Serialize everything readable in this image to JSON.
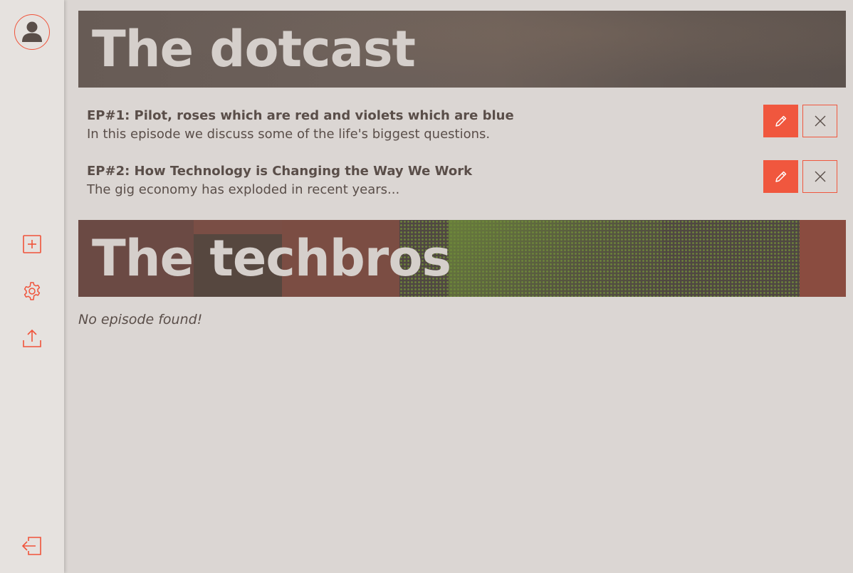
{
  "sidebar": {
    "avatar_icon": "user-avatar-icon",
    "actions": [
      {
        "name": "add-podcast",
        "icon": "plus-square-icon"
      },
      {
        "name": "settings",
        "icon": "gear-icon"
      },
      {
        "name": "upload",
        "icon": "upload-icon"
      }
    ],
    "logout_icon": "logout-icon",
    "accent_color": "#f0533a"
  },
  "podcasts": [
    {
      "title": "The dotcast",
      "episodes": [
        {
          "title": "EP#1: Pilot, roses which are red and violets which are blue",
          "description": "In this episode we discuss some of the life's biggest questions."
        },
        {
          "title": "EP#2: How Technology is Changing the Way We Work",
          "description": "The gig economy has exploded in recent years..."
        }
      ]
    },
    {
      "title": "The techbros",
      "empty_message": "No episode found!"
    }
  ]
}
